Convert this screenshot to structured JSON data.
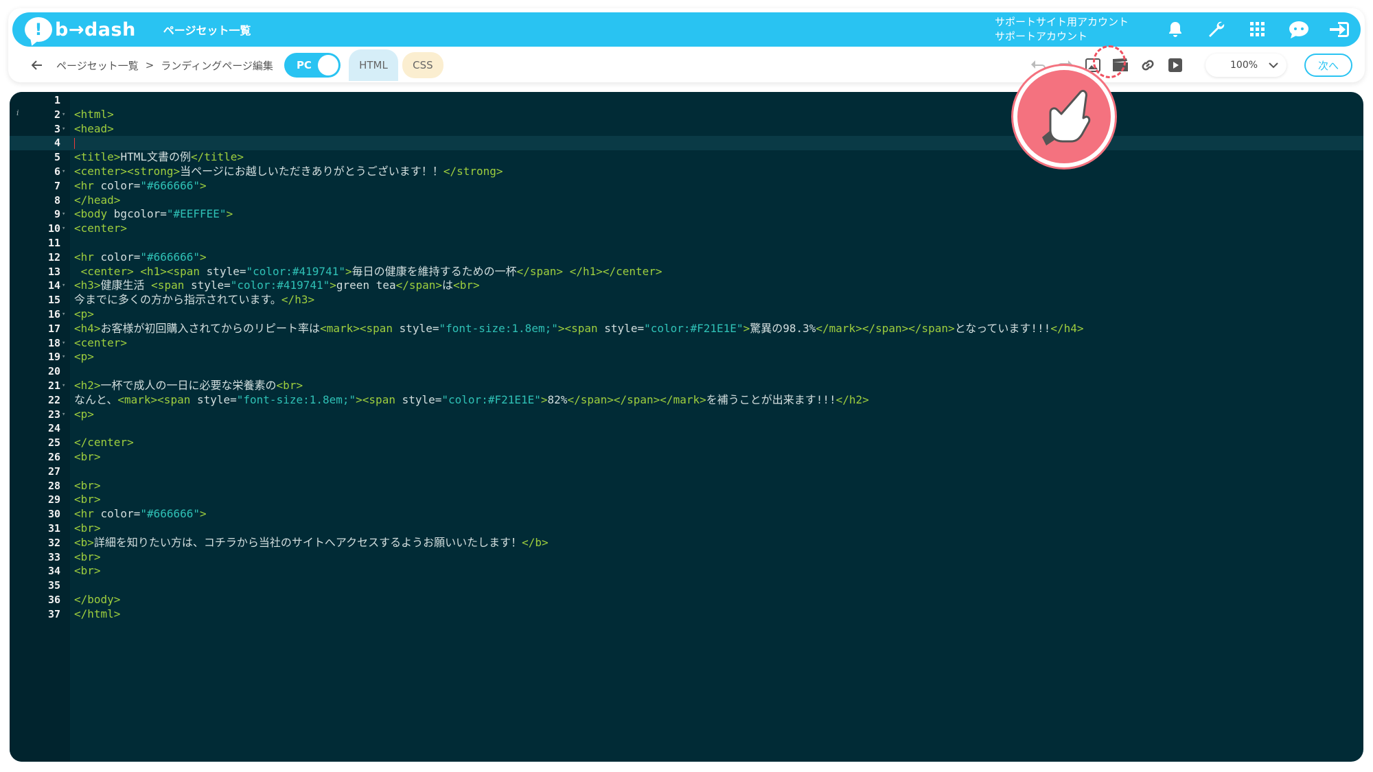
{
  "header": {
    "logo_symbol": "!",
    "logo_text": "b→dash",
    "title": "ページセット一覧",
    "account_line1": "サポートサイト用アカウント",
    "account_line2": "サポートアカウント",
    "icons": [
      "bell-icon",
      "wrench-icon",
      "grid-icon",
      "chat-bot-icon",
      "logout-icon"
    ]
  },
  "toolbar": {
    "breadcrumb": [
      "ページセット一覧",
      ">",
      "ランディングページ編集"
    ],
    "device_toggle": "PC",
    "tabs": [
      "HTML",
      "CSS"
    ],
    "active_tab": "HTML",
    "zoom": "100%",
    "next_button": "次へ",
    "icons": [
      "undo-icon",
      "redo-icon",
      "image-icon",
      "video-icon",
      "link-icon",
      "play-icon"
    ],
    "highlighted_icon": "image-icon"
  },
  "editor": {
    "active_line": 4,
    "lines": [
      {
        "n": "1",
        "fold": ""
      },
      {
        "n": "2",
        "fold": "▾"
      },
      {
        "n": "3",
        "fold": "▾"
      },
      {
        "n": "4",
        "fold": ""
      },
      {
        "n": "5",
        "fold": ""
      },
      {
        "n": "6",
        "fold": "▾"
      },
      {
        "n": "7",
        "fold": ""
      },
      {
        "n": "8",
        "fold": ""
      },
      {
        "n": "9",
        "fold": "▾"
      },
      {
        "n": "10",
        "fold": "▾"
      },
      {
        "n": "11",
        "fold": ""
      },
      {
        "n": "12",
        "fold": ""
      },
      {
        "n": "13",
        "fold": ""
      },
      {
        "n": "14",
        "fold": "▾"
      },
      {
        "n": "15",
        "fold": ""
      },
      {
        "n": "16",
        "fold": "▾"
      },
      {
        "n": "17",
        "fold": ""
      },
      {
        "n": "18",
        "fold": "▾"
      },
      {
        "n": "19",
        "fold": "▾"
      },
      {
        "n": "20",
        "fold": ""
      },
      {
        "n": "21",
        "fold": "▾"
      },
      {
        "n": "22",
        "fold": ""
      },
      {
        "n": "23",
        "fold": "▾"
      },
      {
        "n": "24",
        "fold": ""
      },
      {
        "n": "25",
        "fold": ""
      },
      {
        "n": "26",
        "fold": ""
      },
      {
        "n": "27",
        "fold": ""
      },
      {
        "n": "28",
        "fold": ""
      },
      {
        "n": "29",
        "fold": ""
      },
      {
        "n": "30",
        "fold": ""
      },
      {
        "n": "31",
        "fold": ""
      },
      {
        "n": "32",
        "fold": ""
      },
      {
        "n": "33",
        "fold": ""
      },
      {
        "n": "34",
        "fold": ""
      },
      {
        "n": "35",
        "fold": ""
      },
      {
        "n": "36",
        "fold": ""
      },
      {
        "n": "37",
        "fold": ""
      }
    ],
    "code": [
      [],
      [
        [
          "t",
          "<html>"
        ]
      ],
      [
        [
          "t",
          "<head>"
        ]
      ],
      [],
      [
        [
          "t",
          "<title>"
        ],
        [
          "x",
          "HTML文書の例"
        ],
        [
          "t",
          "</title>"
        ]
      ],
      [
        [
          "t",
          "<center><strong>"
        ],
        [
          "x",
          "当ページにお越しいただきありがとうございます！！"
        ],
        [
          "t",
          "</strong>"
        ]
      ],
      [
        [
          "t",
          "<hr "
        ],
        [
          "a",
          "color="
        ],
        [
          "v",
          "\"#666666\""
        ],
        [
          "t",
          ">"
        ]
      ],
      [
        [
          "t",
          "</head>"
        ]
      ],
      [
        [
          "t",
          "<body "
        ],
        [
          "a",
          "bgcolor="
        ],
        [
          "v",
          "\"#EEFFEE\""
        ],
        [
          "t",
          ">"
        ]
      ],
      [
        [
          "t",
          "<center>"
        ]
      ],
      [],
      [
        [
          "t",
          "<hr "
        ],
        [
          "a",
          "color="
        ],
        [
          "v",
          "\"#666666\""
        ],
        [
          "t",
          ">"
        ]
      ],
      [
        [
          "x",
          " "
        ],
        [
          "t",
          "<center> <h1><span "
        ],
        [
          "a",
          "style="
        ],
        [
          "v",
          "\"color:#419741\""
        ],
        [
          "t",
          ">"
        ],
        [
          "x",
          "毎日の健康を維持するための一杯"
        ],
        [
          "t",
          "</span> </h1></center>"
        ]
      ],
      [
        [
          "t",
          "<h3>"
        ],
        [
          "x",
          "健康生活 "
        ],
        [
          "t",
          "<span "
        ],
        [
          "a",
          "style="
        ],
        [
          "v",
          "\"color:#419741\""
        ],
        [
          "t",
          ">"
        ],
        [
          "x",
          "green tea"
        ],
        [
          "t",
          "</span>"
        ],
        [
          "x",
          "は"
        ],
        [
          "t",
          "<br>"
        ]
      ],
      [
        [
          "x",
          "今までに多くの方から指示されています。"
        ],
        [
          "t",
          "</h3>"
        ]
      ],
      [
        [
          "t",
          "<p>"
        ]
      ],
      [
        [
          "t",
          "<h4>"
        ],
        [
          "x",
          "お客様が初回購入されてからのリピート率は"
        ],
        [
          "t",
          "<mark><span "
        ],
        [
          "a",
          "style="
        ],
        [
          "v",
          "\"font-size:1.8em;\""
        ],
        [
          "t",
          "><span "
        ],
        [
          "a",
          "style="
        ],
        [
          "v",
          "\"color:#F21E1E\""
        ],
        [
          "t",
          ">"
        ],
        [
          "x",
          "驚異の98.3%"
        ],
        [
          "t",
          "</mark></span></span>"
        ],
        [
          "x",
          "となっています!!!"
        ],
        [
          "t",
          "</h4>"
        ]
      ],
      [
        [
          "t",
          "<center>"
        ]
      ],
      [
        [
          "t",
          "<p>"
        ]
      ],
      [],
      [
        [
          "t",
          "<h2>"
        ],
        [
          "x",
          "一杯で成人の一日に必要な栄養素の"
        ],
        [
          "t",
          "<br>"
        ]
      ],
      [
        [
          "x",
          "なんと、"
        ],
        [
          "t",
          "<mark><span "
        ],
        [
          "a",
          "style="
        ],
        [
          "v",
          "\"font-size:1.8em;\""
        ],
        [
          "t",
          "><span "
        ],
        [
          "a",
          "style="
        ],
        [
          "v",
          "\"color:#F21E1E\""
        ],
        [
          "t",
          ">"
        ],
        [
          "x",
          "82%"
        ],
        [
          "t",
          "</span></span></mark>"
        ],
        [
          "x",
          "を補うことが出来ます!!!"
        ],
        [
          "t",
          "</h2>"
        ]
      ],
      [
        [
          "t",
          "<p>"
        ]
      ],
      [],
      [
        [
          "t",
          "</center>"
        ]
      ],
      [
        [
          "t",
          "<br>"
        ]
      ],
      [],
      [
        [
          "t",
          "<br>"
        ]
      ],
      [
        [
          "t",
          "<br>"
        ]
      ],
      [
        [
          "t",
          "<hr "
        ],
        [
          "a",
          "color="
        ],
        [
          "v",
          "\"#666666\""
        ],
        [
          "t",
          ">"
        ]
      ],
      [
        [
          "t",
          "<br>"
        ]
      ],
      [
        [
          "t",
          "<b>"
        ],
        [
          "x",
          "詳細を知りたい方は、コチラから当社のサイトへアクセスするようお願いいたします！"
        ],
        [
          "t",
          "</b>"
        ]
      ],
      [
        [
          "t",
          "<br>"
        ]
      ],
      [
        [
          "t",
          "<br>"
        ]
      ],
      [],
      [
        [
          "t",
          "</body>"
        ]
      ],
      [
        [
          "t",
          "</html>"
        ]
      ]
    ]
  },
  "colors": {
    "brand": "#29c3f2",
    "editor_bg": "#012b36",
    "tag": "#9fcf3e",
    "attr_value": "#2fc1b6",
    "highlight": "#f4727f"
  }
}
